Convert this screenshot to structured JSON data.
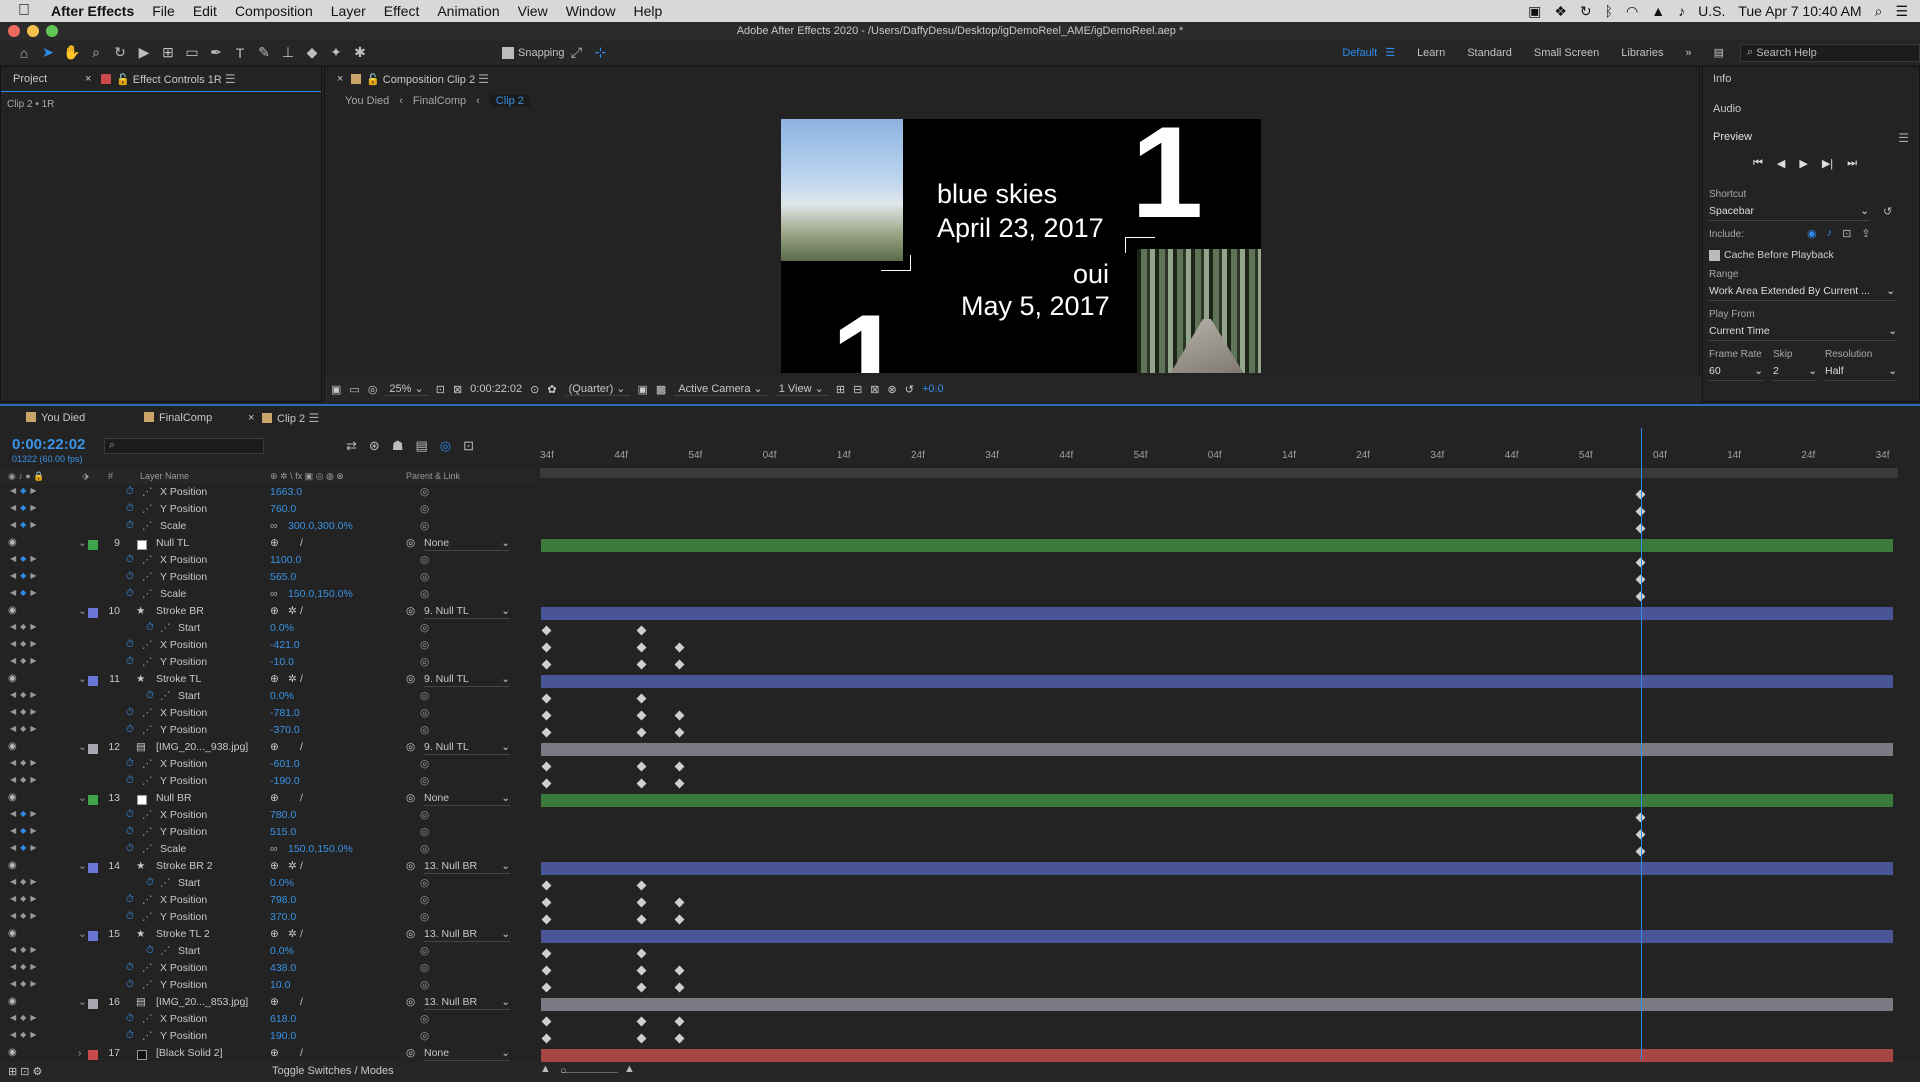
{
  "menubar": {
    "app": "After Effects",
    "items": [
      "File",
      "Edit",
      "Composition",
      "Layer",
      "Effect",
      "Animation",
      "View",
      "Window",
      "Help"
    ],
    "locale": "U.S.",
    "clock": "Tue Apr 7  10:40 AM"
  },
  "window_title": "Adobe After Effects 2020 - /Users/DaffyDesu/Desktop/igDemoReel_AME/igDemoReel.aep *",
  "toolbar": {
    "snapping": "Snapping",
    "workspaces": [
      "Default",
      "Learn",
      "Standard",
      "Small Screen",
      "Libraries"
    ],
    "search_placeholder": "Search Help"
  },
  "left_panel": {
    "tab_project": "Project",
    "tab_effect": "Effect Controls 1R",
    "subtitle": "Clip 2 • 1R"
  },
  "comp_panel": {
    "tab": "Composition Clip 2",
    "breadcrumbs": [
      "You Died",
      "FinalComp",
      "Clip 2"
    ],
    "viewer": {
      "line1": "blue skies",
      "line2": "April 23, 2017",
      "line3": "oui",
      "line4": "May 5, 2017",
      "num": "1"
    },
    "bar": {
      "zoom": "25%",
      "time": "0:00:22:02",
      "quality": "(Quarter)",
      "camera": "Active Camera",
      "views": "1 View",
      "exposure": "+0.0"
    }
  },
  "right_panel": {
    "info": "Info",
    "audio": "Audio",
    "preview": "Preview",
    "shortcut_label": "Shortcut",
    "shortcut": "Spacebar",
    "include_label": "Include:",
    "cache": "Cache Before Playback",
    "range_label": "Range",
    "range": "Work Area Extended By Current ...",
    "play_from_label": "Play From",
    "play_from": "Current Time",
    "frame_rate_label": "Frame Rate",
    "skip_label": "Skip",
    "resolution_label": "Resolution",
    "frame_rate": "60",
    "skip": "2",
    "resolution": "Half"
  },
  "timeline": {
    "tabs": [
      "You Died",
      "FinalComp",
      "Clip 2"
    ],
    "timecode": "0:00:22:02",
    "frames": "01322 (60.00 fps)",
    "col_layer_name": "Layer Name",
    "col_parent": "Parent & Link",
    "ruler": [
      "34f",
      "44f",
      "54f",
      "04f",
      "14f",
      "24f",
      "34f",
      "44f",
      "54f",
      "04f",
      "14f",
      "24f",
      "34f",
      "44f",
      "54f",
      "04f",
      "14f",
      "24f",
      "34f"
    ],
    "toggle": "Toggle Switches / Modes",
    "rows": [
      {
        "type": "prop",
        "name": "X Position",
        "value": "1663.0",
        "kf": true
      },
      {
        "type": "prop",
        "name": "Y Position",
        "value": "760.0",
        "kf": true
      },
      {
        "type": "prop",
        "name": "Scale",
        "value": "300.0,300.0%",
        "kf": true,
        "link": true
      },
      {
        "type": "layer",
        "num": "9",
        "name": "Null TL",
        "color": "#ffffff",
        "label": "#3ea54b",
        "parent": "None",
        "bar": "#3a7a3a"
      },
      {
        "type": "prop",
        "name": "X Position",
        "value": "1100.0",
        "kf": true
      },
      {
        "type": "prop",
        "name": "Y Position",
        "value": "565.0",
        "kf": true
      },
      {
        "type": "prop",
        "name": "Scale",
        "value": "150.0,150.0%",
        "kf": true,
        "link": true
      },
      {
        "type": "layer",
        "num": "10",
        "name": "Stroke BR",
        "star": true,
        "label": "#6a76d6",
        "parent": "9. Null TL",
        "bar": "#4a5598"
      },
      {
        "type": "prop",
        "name": "Start",
        "value": "0.0%",
        "indent": true
      },
      {
        "type": "prop",
        "name": "X Position",
        "value": "-421.0"
      },
      {
        "type": "prop",
        "name": "Y Position",
        "value": "-10.0"
      },
      {
        "type": "layer",
        "num": "11",
        "name": "Stroke TL",
        "star": true,
        "label": "#6a76d6",
        "parent": "9. Null TL",
        "bar": "#4a5598"
      },
      {
        "type": "prop",
        "name": "Start",
        "value": "0.0%",
        "indent": true
      },
      {
        "type": "prop",
        "name": "X Position",
        "value": "-781.0"
      },
      {
        "type": "prop",
        "name": "Y Position",
        "value": "-370.0"
      },
      {
        "type": "layer",
        "num": "12",
        "name": "[IMG_20..._938.jpg]",
        "file": true,
        "label": "#a7a7b2",
        "parent": "9. Null TL",
        "bar": "#7a7a82"
      },
      {
        "type": "prop",
        "name": "X Position",
        "value": "-601.0"
      },
      {
        "type": "prop",
        "name": "Y Position",
        "value": "-190.0"
      },
      {
        "type": "layer",
        "num": "13",
        "name": "Null BR",
        "color": "#ffffff",
        "label": "#3ea54b",
        "parent": "None",
        "bar": "#3a7a3a"
      },
      {
        "type": "prop",
        "name": "X Position",
        "value": "780.0",
        "kf": true
      },
      {
        "type": "prop",
        "name": "Y Position",
        "value": "515.0",
        "kf": true
      },
      {
        "type": "prop",
        "name": "Scale",
        "value": "150.0,150.0%",
        "kf": true,
        "link": true
      },
      {
        "type": "layer",
        "num": "14",
        "name": "Stroke BR 2",
        "star": true,
        "label": "#6a76d6",
        "parent": "13. Null BR",
        "bar": "#4a5598"
      },
      {
        "type": "prop",
        "name": "Start",
        "value": "0.0%",
        "indent": true
      },
      {
        "type": "prop",
        "name": "X Position",
        "value": "798.0"
      },
      {
        "type": "prop",
        "name": "Y Position",
        "value": "370.0"
      },
      {
        "type": "layer",
        "num": "15",
        "name": "Stroke TL 2",
        "star": true,
        "label": "#6a76d6",
        "parent": "13. Null BR",
        "bar": "#4a5598"
      },
      {
        "type": "prop",
        "name": "Start",
        "value": "0.0%",
        "indent": true
      },
      {
        "type": "prop",
        "name": "X Position",
        "value": "438.0"
      },
      {
        "type": "prop",
        "name": "Y Position",
        "value": "10.0"
      },
      {
        "type": "layer",
        "num": "16",
        "name": "[IMG_20..._853.jpg]",
        "file": true,
        "label": "#a7a7b2",
        "parent": "13. Null BR",
        "bar": "#7a7a82"
      },
      {
        "type": "prop",
        "name": "X Position",
        "value": "618.0"
      },
      {
        "type": "prop",
        "name": "Y Position",
        "value": "190.0"
      },
      {
        "type": "layer",
        "num": "17",
        "name": "[Black Solid 2]",
        "color": "#111111",
        "label": "#c84a4a",
        "parent": "None",
        "bar": "#a84545",
        "collapsed": true
      }
    ]
  },
  "colors": {
    "accent": "#2d8ceb"
  }
}
